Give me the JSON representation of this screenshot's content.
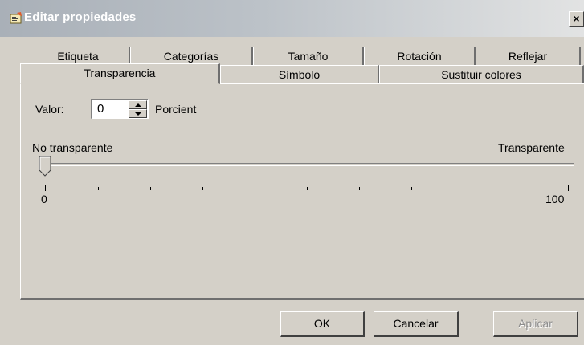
{
  "window": {
    "title": "Editar propiedades",
    "close_label": "×"
  },
  "tabs": {
    "back_row": [
      {
        "label": "Etiqueta"
      },
      {
        "label": "Categorías"
      },
      {
        "label": "Tamaño"
      },
      {
        "label": "Rotación"
      },
      {
        "label": "Reflejar"
      }
    ],
    "front_row": [
      {
        "label": "Transparencia",
        "active": true
      },
      {
        "label": "Símbolo"
      },
      {
        "label": "Sustituir colores"
      }
    ]
  },
  "transparency": {
    "valor_label": "Valor:",
    "value": "0",
    "unit_label": "Porcient",
    "left_label": "No transparente",
    "right_label": "Transparente",
    "min_label": "0",
    "max_label": "100",
    "slider_value": 0
  },
  "buttons": {
    "ok": "OK",
    "cancel": "Cancelar",
    "apply": "Aplicar"
  }
}
